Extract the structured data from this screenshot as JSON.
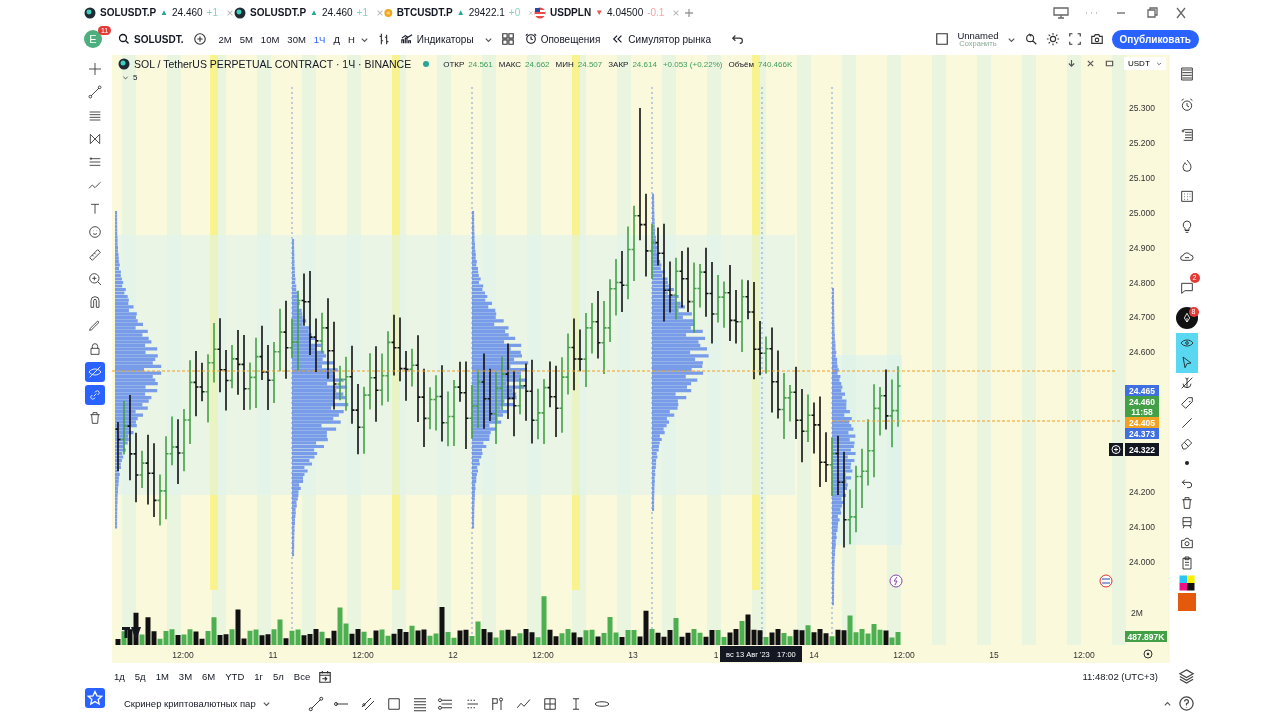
{
  "browser_tabs": [
    {
      "kind": "dark-coin",
      "symbol": "SOLUSDT.P",
      "arrow": "▲",
      "falling": false,
      "price": "24.460",
      "change": "+1"
    },
    {
      "kind": "dark-coin",
      "symbol": "SOLUSDT.P",
      "arrow": "▲",
      "falling": false,
      "price": "24.460",
      "change": "+1"
    },
    {
      "kind": "gold-coin",
      "symbol": "BTCUSDT.P",
      "arrow": "▲",
      "falling": false,
      "price": "29422.1",
      "change": "+0"
    },
    {
      "kind": "flag",
      "symbol": "USDPLN",
      "arrow": "▼",
      "falling": true,
      "price": "4.04500",
      "change": "-0.1"
    }
  ],
  "toolbar": {
    "avatar": "E",
    "avatar_badge": "11",
    "symbol": "SOLUSDT.",
    "intervals": [
      {
        "label": "2M",
        "selected": false
      },
      {
        "label": "5M",
        "selected": false
      },
      {
        "label": "10M",
        "selected": false
      },
      {
        "label": "30M",
        "selected": false
      },
      {
        "label": "1Ч",
        "selected": true
      },
      {
        "label": "Д",
        "selected": false
      },
      {
        "label": "Н",
        "selected": false
      }
    ],
    "indicators": "Индикаторы",
    "alerts": "Оповещения",
    "replay": "Симулятор рынка",
    "layout_name": "Unnamed",
    "layout_status": "Сохранить",
    "publish": "Опубликовать"
  },
  "legend": {
    "title": "SOL / TetherUS PERPETUAL CONTRACT · 1Ч · BINANCE",
    "fields": [
      {
        "label": "ОТКР",
        "value": "24.561"
      },
      {
        "label": "МАКС",
        "value": "24.662"
      },
      {
        "label": "МИН",
        "value": "24.507"
      },
      {
        "label": "ЗАКР",
        "value": "24.614"
      }
    ],
    "change": "+0.053 (+0.22%)",
    "volume_label": "Объём",
    "volume_value": "740.466K",
    "indicator_count": "5"
  },
  "currency": "USDT",
  "price_ticks": [
    "25.300",
    "25.200",
    "25.100",
    "25.000",
    "24.900",
    "24.800",
    "24.700",
    "24.600",
    "24.200",
    "24.100",
    "24.000"
  ],
  "price_labels": [
    {
      "text": "24.465",
      "color": "#3f6fe0"
    },
    {
      "text": "24.460",
      "sub": "11:58",
      "color": "#43a047"
    },
    {
      "text": "24.405",
      "color": "#f2a223"
    },
    {
      "text": "24.373",
      "color": "#3f6fe0"
    }
  ],
  "crosshair_price": "24.322",
  "volume": {
    "axis_label": "2M",
    "last": "487.897K"
  },
  "time_labels": [
    "12:00",
    "11",
    "12:00",
    "12",
    "12:00",
    "13",
    "1",
    "14",
    "12:00",
    "15",
    "12:00"
  ],
  "crosshair_time": {
    "date": "вс 13 Авг '23",
    "time": "17:00"
  },
  "left_toolbar": [
    {
      "active": false
    },
    {
      "active": false
    },
    {
      "active": false
    },
    {
      "active": false
    },
    {
      "active": false
    },
    {
      "active": false
    },
    {
      "active": false
    },
    {
      "active": false
    },
    {
      "active": false
    },
    {
      "active": false
    },
    {
      "active": false
    },
    {
      "active": false
    },
    {
      "active": false
    },
    {
      "active": true
    },
    {
      "active": true
    },
    {
      "active": false
    }
  ],
  "right_toolbar": [
    {
      "active": false
    },
    {
      "active": false
    },
    {
      "active": false
    },
    {
      "active": false
    },
    {
      "active": false
    },
    {
      "active": false
    },
    {
      "active": false
    },
    {
      "active": false,
      "badge": "2"
    },
    {
      "active": false,
      "badge": "8"
    },
    {
      "active": true
    },
    {
      "active": true
    },
    {
      "active": false
    },
    {
      "active": false
    },
    {
      "active": false
    },
    {
      "active": false
    },
    {
      "active": false
    },
    {
      "active": false
    },
    {
      "active": false
    },
    {
      "active": false
    },
    {
      "active": false
    },
    {
      "active": false
    },
    {
      "active": false
    }
  ],
  "ranges": [
    "1д",
    "5д",
    "1М",
    "3М",
    "6М",
    "YTD",
    "1г",
    "5л",
    "Все"
  ],
  "clock": "11:48:02 (UTC+3)",
  "screener": "Скринер криптовалютных пар"
}
